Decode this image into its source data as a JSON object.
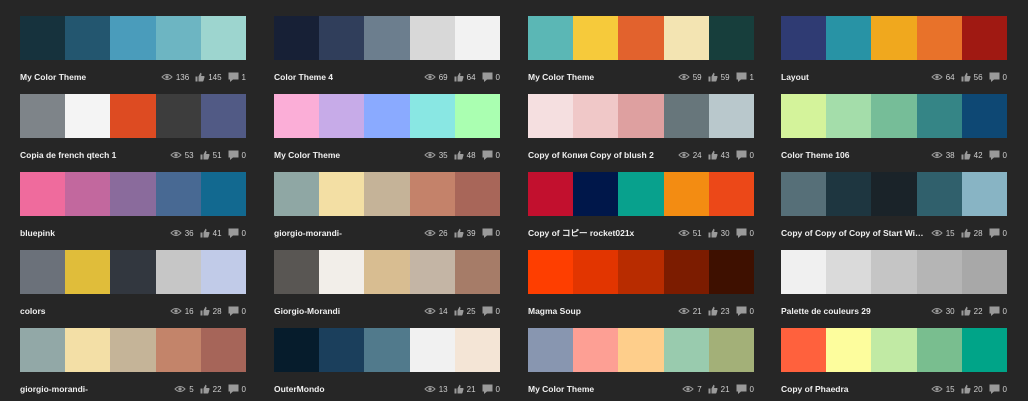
{
  "colors": {
    "background": "#262626",
    "text": "#f0f0f0",
    "icon": "#9a9a9a"
  },
  "icons": {
    "views": "eye-icon",
    "likes": "thumbs-up-icon",
    "comments": "comment-icon"
  },
  "themes": [
    {
      "title": "My Color Theme",
      "views": "136",
      "likes": "145",
      "comments": "1",
      "swatches": [
        "#16323d",
        "#23566f",
        "#4a9cbb",
        "#6db5c2",
        "#9dd5cf"
      ]
    },
    {
      "title": "Color Theme 4",
      "views": "69",
      "likes": "64",
      "comments": "0",
      "swatches": [
        "#172036",
        "#303e5b",
        "#6c7e8e",
        "#d8d8d8",
        "#f2f2f2"
      ]
    },
    {
      "title": "My Color Theme",
      "views": "59",
      "likes": "59",
      "comments": "1",
      "swatches": [
        "#5bb7b5",
        "#f6ca3b",
        "#e2622d",
        "#f3e4b2",
        "#173e3c"
      ]
    },
    {
      "title": "Layout",
      "views": "64",
      "likes": "56",
      "comments": "0",
      "swatches": [
        "#2f3b73",
        "#2893a5",
        "#f0a81e",
        "#e8722a",
        "#a01912"
      ]
    },
    {
      "title": "Copia de french qtech 1",
      "views": "53",
      "likes": "51",
      "comments": "0",
      "swatches": [
        "#7e8489",
        "#f4f4f4",
        "#dd4b22",
        "#3d3d3d",
        "#515a85"
      ]
    },
    {
      "title": "My Color Theme",
      "views": "35",
      "likes": "48",
      "comments": "0",
      "swatches": [
        "#fbaed7",
        "#c7abe8",
        "#8aaaff",
        "#89e7e3",
        "#aaffb1"
      ]
    },
    {
      "title": "Copy of Копия Copy of blush 2",
      "views": "24",
      "likes": "43",
      "comments": "0",
      "swatches": [
        "#f5dfe0",
        "#f0c8c8",
        "#dea0a0",
        "#67767b",
        "#b9c8cc"
      ]
    },
    {
      "title": "Color Theme 106",
      "views": "38",
      "likes": "42",
      "comments": "0",
      "swatches": [
        "#d4f39b",
        "#a4ddaa",
        "#76bd98",
        "#358586",
        "#0e4874"
      ]
    },
    {
      "title": "bluepink",
      "views": "36",
      "likes": "41",
      "comments": "0",
      "swatches": [
        "#ef6b9d",
        "#c2689e",
        "#8a6b9c",
        "#486993",
        "#126990"
      ]
    },
    {
      "title": "giorgio-morandi-",
      "views": "26",
      "likes": "39",
      "comments": "0",
      "swatches": [
        "#8fa7a4",
        "#f3dfa4",
        "#c5b398",
        "#c4826a",
        "#a86659"
      ]
    },
    {
      "title": "Copy of コピー rocket021x",
      "views": "51",
      "likes": "30",
      "comments": "0",
      "swatches": [
        "#c2102e",
        "#00174a",
        "#08a18d",
        "#f38c12",
        "#ec4818"
      ]
    },
    {
      "title": "Copy of Copy of Copy of Start Wit...",
      "views": "15",
      "likes": "28",
      "comments": "0",
      "swatches": [
        "#566f78",
        "#1e3640",
        "#1a2329",
        "#30606c",
        "#88b4c4"
      ]
    },
    {
      "title": "colors",
      "views": "16",
      "likes": "28",
      "comments": "0",
      "swatches": [
        "#6b717a",
        "#e0bd3a",
        "#32373f",
        "#c6c6c6",
        "#c1cbe8"
      ]
    },
    {
      "title": "Giorgio-Morandi",
      "views": "14",
      "likes": "25",
      "comments": "0",
      "swatches": [
        "#595653",
        "#f2eee9",
        "#d8bd91",
        "#c4b5a5",
        "#a67c68"
      ]
    },
    {
      "title": "Magma Soup",
      "views": "21",
      "likes": "23",
      "comments": "0",
      "swatches": [
        "#fe3e00",
        "#e23500",
        "#b82c00",
        "#7c1c00",
        "#3e1000"
      ]
    },
    {
      "title": "Palette de couleurs 29",
      "views": "30",
      "likes": "22",
      "comments": "0",
      "swatches": [
        "#f0f0f0",
        "#dadada",
        "#c5c5c5",
        "#b5b5b5",
        "#a8a8a8"
      ]
    },
    {
      "title": "giorgio-morandi-",
      "views": "5",
      "likes": "22",
      "comments": "0",
      "swatches": [
        "#92a8a7",
        "#f3dfa6",
        "#c5b498",
        "#c3846a",
        "#a66559"
      ]
    },
    {
      "title": "OuterMondo",
      "views": "13",
      "likes": "21",
      "comments": "0",
      "swatches": [
        "#061c2c",
        "#1b3f5c",
        "#517a8c",
        "#f1f1f1",
        "#f4e5d6"
      ]
    },
    {
      "title": "My Color Theme",
      "views": "7",
      "likes": "21",
      "comments": "0",
      "swatches": [
        "#8896b0",
        "#fd9f94",
        "#fece8b",
        "#99cbae",
        "#a3b078"
      ]
    },
    {
      "title": "Copy of Phaedra",
      "views": "15",
      "likes": "20",
      "comments": "0",
      "swatches": [
        "#ff613d",
        "#fdfd9d",
        "#c1eaa4",
        "#79be8f",
        "#00a488"
      ]
    }
  ]
}
